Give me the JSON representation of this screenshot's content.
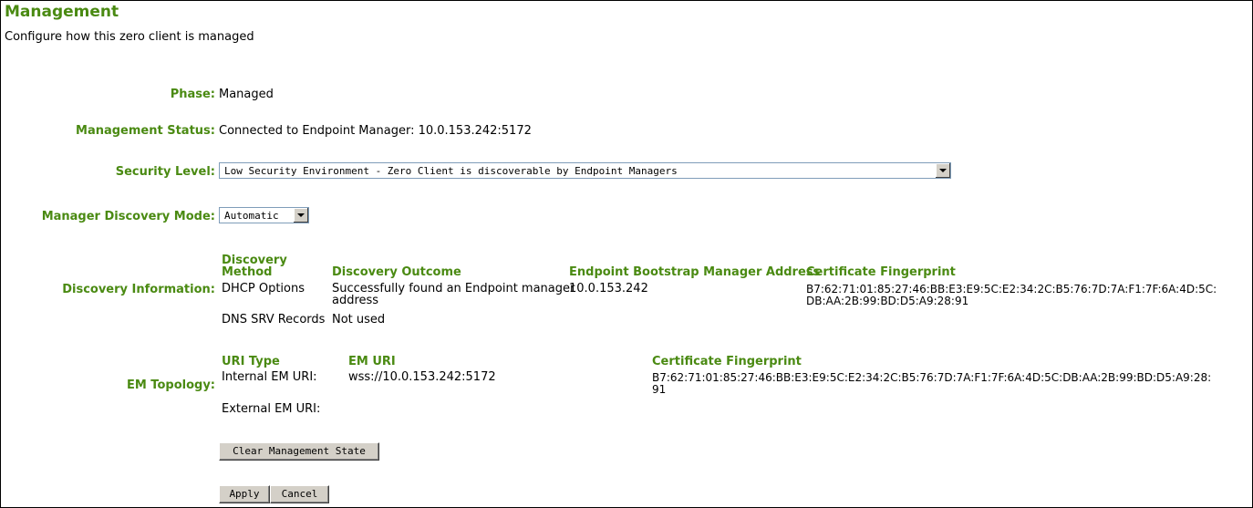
{
  "header": {
    "title": "Management",
    "subtitle": "Configure how this zero client is managed"
  },
  "phase": {
    "label": "Phase:",
    "value": "Managed"
  },
  "management_status": {
    "label": "Management Status:",
    "value": "Connected to Endpoint Manager: 10.0.153.242:5172"
  },
  "security_level": {
    "label": "Security Level:",
    "selected": "Low Security Environment - Zero Client is discoverable by Endpoint Managers"
  },
  "discovery_mode": {
    "label": "Manager Discovery Mode:",
    "selected": "Automatic"
  },
  "discovery_info": {
    "label": "Discovery Information:",
    "headers": {
      "method_line1": "Discovery",
      "method_line2": "Method",
      "outcome": "Discovery Outcome",
      "address": "Endpoint Bootstrap Manager Address",
      "fingerprint": "Certificate Fingerprint"
    },
    "rows": [
      {
        "method": "DHCP Options",
        "outcome_line1": "Successfully found an Endpoint manager",
        "outcome_line2": "address",
        "address": "10.0.153.242",
        "fingerprint_line1": "B7:62:71:01:85:27:46:BB:E3:E9:5C:E2:34:2C:B5:76:7D:7A:F1:7F:6A:4D:5C:",
        "fingerprint_line2": "DB:AA:2B:99:BD:D5:A9:28:91"
      },
      {
        "method": "DNS SRV Records",
        "outcome_line1": "Not used"
      }
    ]
  },
  "em_topology": {
    "label": "EM Topology:",
    "headers": {
      "uri_type": "URI Type",
      "em_uri": "EM URI",
      "fingerprint": "Certificate Fingerprint"
    },
    "rows": [
      {
        "uri_type": "Internal EM URI:",
        "em_uri": "wss://10.0.153.242:5172",
        "fingerprint_line1": "B7:62:71:01:85:27:46:BB:E3:E9:5C:E2:34:2C:B5:76:7D:7A:F1:7F:6A:4D:5C:DB:AA:2B:99:BD:D5:A9:28:",
        "fingerprint_line2": "91"
      },
      {
        "uri_type": "External EM URI:"
      }
    ]
  },
  "buttons": {
    "clear": "Clear Management State",
    "apply": "Apply",
    "cancel": "Cancel"
  }
}
